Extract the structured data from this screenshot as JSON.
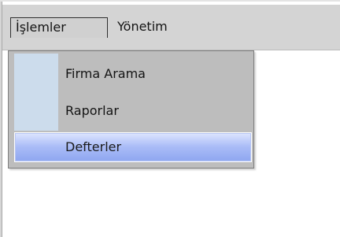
{
  "menubar": {
    "menus": [
      {
        "label": "İşlemler"
      },
      {
        "label": "Yönetim"
      }
    ]
  },
  "dropdown": {
    "items": [
      {
        "label": "Firma Arama"
      },
      {
        "label": "Raporlar"
      },
      {
        "label": "Defterler"
      }
    ]
  },
  "colors": {
    "menubar_background": "#d4d4d4",
    "dropdown_background": "#bdbdbd",
    "icon_column": "#ccdcec",
    "selected_item_gradient_start": "#dde5ff",
    "selected_item_gradient_end": "#8ea6f0"
  }
}
